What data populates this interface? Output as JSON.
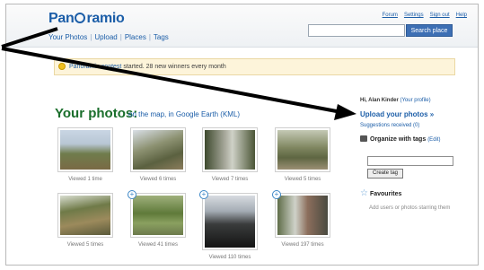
{
  "header": {
    "logo": "Pan",
    "logo_rest": "ramio",
    "nav": [
      "Your Photos",
      "Upload",
      "Places",
      "Tags"
    ],
    "top_links": [
      "Forum",
      "Settings",
      "Sign out",
      "Help"
    ],
    "search_button": "Search place",
    "search_value": ""
  },
  "notice": {
    "link": "Panoramio contest",
    "text": " started. 28 new winners every month"
  },
  "photos": {
    "title": "Your photos:",
    "sub_map": "on the map,",
    "sub_earth": "in Google Earth (KML)",
    "items": [
      {
        "caption": "Viewed 1 time"
      },
      {
        "caption": "Viewed 6 times"
      },
      {
        "caption": "Viewed 7 times"
      },
      {
        "caption": "Viewed 5 times"
      },
      {
        "caption": "Viewed 5 times"
      },
      {
        "caption": "Viewed 41 times"
      },
      {
        "caption": "Viewed 110 times"
      },
      {
        "caption": "Viewed 197 times"
      }
    ]
  },
  "sidebar": {
    "greeting": "Hi, Alan Kinder",
    "profile_link": "(Your profile)",
    "upload": "Upload your photos »",
    "suggestions": "Suggestions received (0)",
    "organize": "Organize with tags",
    "edit": "(Edit)",
    "tag_value": "",
    "create_tag": "Create tag",
    "favourites": "Favourites",
    "favourites_note": "Add users or photos starring them"
  },
  "colors": {
    "brand": "#1c5ea8",
    "title_green": "#1a6e2b",
    "notice_bg": "#fdf4da"
  }
}
